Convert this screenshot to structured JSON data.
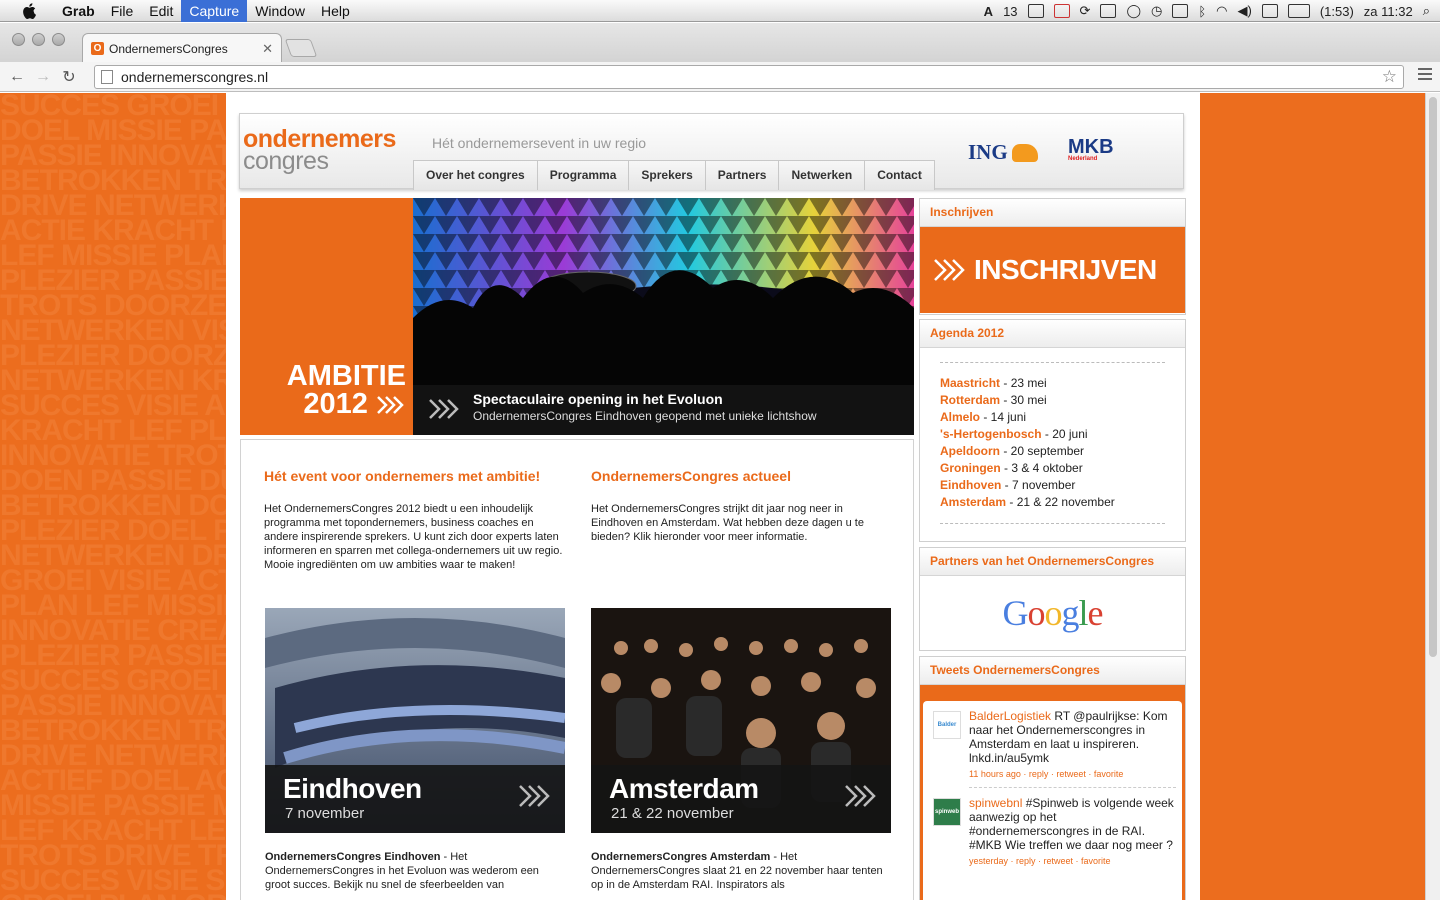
{
  "menubar": {
    "app": "Grab",
    "items": [
      "File",
      "Edit",
      "Capture",
      "Window",
      "Help"
    ],
    "status": {
      "adobe_count": "13",
      "battery": "(1:53)",
      "clock": "za 11:32"
    }
  },
  "browser": {
    "tab_title": "OndernemersCongres",
    "tab_favicon": "O",
    "url": "ondernemerscongres.nl"
  },
  "site": {
    "logo_line1": "ondernemers",
    "logo_line2": "congres",
    "tagline": "Hét ondernemersevent in uw regio",
    "nav": [
      "Over het congres",
      "Programma",
      "Sprekers",
      "Partners",
      "Netwerken",
      "Contact"
    ],
    "sponsor1": "ING",
    "sponsor2": "MKB",
    "sponsor2_sub": "Nederland",
    "hero": {
      "title_line1": "AMBITIE",
      "title_line2": "2012",
      "caption_title": "Spectaculaire opening in het Evoluon",
      "caption_sub": "OndernemersCongres Eindhoven geopend met unieke lichtshow"
    },
    "col1": {
      "heading": "Hét event voor ondernemers met ambitie!",
      "body": "Het OndernemersCongres 2012 biedt u een inhoudelijk programma met topondernemers, business coaches en andere inspirerende sprekers. U kunt zich door experts laten informeren en sparren met collega-ondernemers uit uw regio. Mooie ingrediënten om uw ambities waar te maken!"
    },
    "col2": {
      "heading": "OndernemersCongres actueel",
      "body": "Het OndernemersCongres strijkt dit jaar nog neer in Eindhoven en Amsterdam. Wat hebben deze dagen u te bieden? Klik hieronder voor meer informatie."
    },
    "card1": {
      "city": "Eindhoven",
      "date": "7 november",
      "text_bold": "OndernemersCongres Eindhoven",
      "text": " - Het OndernemersCongres in het Evoluon was wederom een groot succes.  Bekijk nu snel de sfeerbeelden van"
    },
    "card2": {
      "city": "Amsterdam",
      "date": "21 & 22 november",
      "text_bold": "OndernemersCongres Amsterdam",
      "text": " - Het OndernemersCongres slaat 21 en 22 november haar tenten op in de Amsterdam RAI. Inspirators als"
    },
    "sidebar": {
      "signup_header": "Inschrijven",
      "signup_button": "INSCHRIJVEN",
      "agenda_header": "Agenda 2012",
      "agenda": [
        {
          "city": "Maastricht",
          "date": " - 23 mei"
        },
        {
          "city": "Rotterdam",
          "date": " - 30 mei"
        },
        {
          "city": "Almelo",
          "date": " - 14 juni"
        },
        {
          "city": "'s-Hertogenbosch",
          "date": " - 20 juni"
        },
        {
          "city": "Apeldoorn",
          "date": " - 20 september"
        },
        {
          "city": "Groningen",
          "date": " - 3 & 4 oktober"
        },
        {
          "city": "Eindhoven",
          "date": " - 7 november"
        },
        {
          "city": "Amsterdam",
          "date": " - 21 & 22 november"
        }
      ],
      "partners_header": "Partners van het OndernemersCongres",
      "partner_logo": "Google",
      "tweets_header": "Tweets OndernemersCongres",
      "tweets": [
        {
          "avatar": "Balder",
          "user": "BalderLogistiek",
          "text": " RT @paulrijkse: Kom naar het Ondernemerscongres in Amsterdam en laat u inspireren. lnkd.in/au5ymk",
          "meta": "11 hours ago · reply · retweet · favorite"
        },
        {
          "avatar": "spinweb",
          "user": "spinwebnl",
          "text": " #Spinweb is volgende week aanwezig op het #ondernemerscongres in de RAI. #MKB Wie treffen we daar nog meer ?",
          "meta": "yesterday · reply · retweet · favorite"
        }
      ]
    }
  },
  "background_words": [
    "SUCCES GROEI VISIE ACTIEF SUCCES GROEI VISIE ACTIEF SUCCES",
    "DOEL MISSIE PASSIE INNOVATIE DOEL MISSIE PASSIE INNOVATIE",
    "PASSIE INNOVATIE CREATIEF PASSIE INNOVATIE CREATIEF PASSIE",
    "BETROKKEN TROTS DOORZETTEN BETROKKEN TROTS DOORZETTEN",
    "DRIVE NETWERKEN PLAN DRIVE NETWERKEN PLAN DRIVE NETWERKEN",
    "ACTIE KRACHT LEF ACTIE KRACHT LEF ACTIE KRACHT LEF ACTIE",
    "LEF MISSIE PLAN ACTIEF DOEL LEF MISSIE PLAN ACTIEF DOEL",
    "PLEZIER PASSIE TROTS PLEZIER PASSIE TROTS PLEZIER PASSIE",
    "TROTS DOORZETTEN DRIVE TROTS DOORZETTEN DRIVE TROTS",
    "NETWERKEN VISIE SUCCES NETWERKEN VISIE SUCCES NETWERKEN",
    "PLEZIER DOORZETTEN LEF PLEZIER DOORZETTEN LEF PLEZIER",
    "NETWERKEN KRACHT DOEL NETWERKEN KRACHT DOEL NETWERKEN",
    "SUCCES VISIE ACTIEF SUCCES VISIE ACTIEF SUCCES VISIE",
    "KRACHT LEF PLEZIER KRACHT LEF PLEZIER KRACHT LEF PLEZIER",
    "INNOVATIE TROTS CREATIEF INNOVATIE TROTS CREATIEF",
    "DOEN PASSIE DURF DOEN PASSIE DURF DOEN PASSIE DURF DOEN",
    "BETROKKEN DOEL MISSIE BETROKKEN DOEL MISSIE BETROKKEN",
    "PLEZIER DOEL PLEZIER DOEL PLEZIER DOEL PLEZIER DOEL",
    "NETWERKEN DRIVE NETWERKEN DRIVE NETWERKEN DRIVE",
    "GROEI VISIE ACTIE GROEI VISIE ACTIE GROEI VISIE ACTIE",
    "PLAN LEF MISSIE PLAN LEF MISSIE PLAN LEF MISSIE PLAN",
    "INNOVATIE CREATIEF INNOVATIE CREATIEF INNOVATIE",
    "PLEZIER PASSIE PLEZIER PASSIE PLEZIER PASSIE PLEZIER",
    "SUCCES GROEI SUCCES GROEI SUCCES GROEI SUCCES GROEI",
    "PASSIE INNOVATIE PASSIE INNOVATIE PASSIE INNOVATIE",
    "BETROKKEN TROTS BETROKKEN TROTS BETROKKEN TROTS",
    "DRIVE NETWERKEN DRIVE NETWERKEN DRIVE NETWERKEN",
    "ACTIEF DOEL ACTIEF DOEL ACTIEF DOEL ACTIEF DOEL ACTIEF",
    "MISSIE PASSIE MISSIE PASSIE MISSIE PASSIE MISSIE PASSIE",
    "LEF KRACHT LEF KRACHT LEF KRACHT LEF KRACHT LEF KRACHT",
    "TROTS DRIVE TROTS DRIVE TROTS DRIVE TROTS DRIVE TROTS",
    "SUCCES VISIE SUCCES VISIE SUCCES VISIE SUCCES VISIE",
    "GROEI PLAN GROEI PLAN GROEI PLAN GROEI PLAN GROEI PLAN"
  ],
  "colors": {
    "brand_orange": "#ea6a1a",
    "navy": "#1b3b86"
  }
}
